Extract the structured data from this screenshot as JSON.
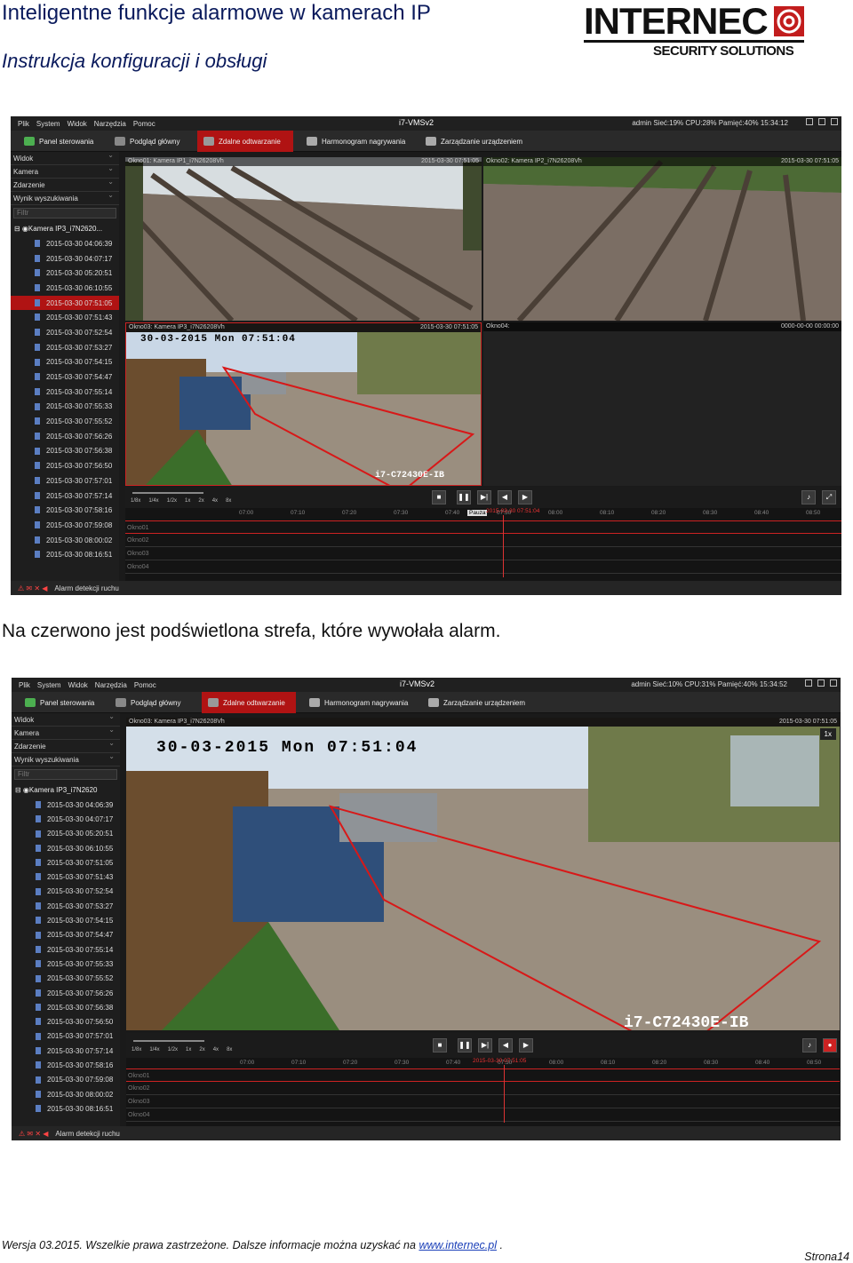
{
  "header": {
    "title": "Inteligentne funkcje alarmowe w kamerach IP",
    "subtitle": "Instrukcja konfiguracji i obsługi"
  },
  "logo": {
    "brand": "INTERNEC",
    "tagline": "SECURITY SOLUTIONS"
  },
  "caption": "Na czerwono jest podświetlona strefa, które wywołała alarm.",
  "footer": {
    "text": "Wersja 03.2015. Wszelkie prawa zastrzeżone. Dalsze informacje można uzyskać na",
    "link": "www.internec.pl",
    "end": " .",
    "page": "Strona14"
  },
  "app": {
    "menu": [
      "Plik",
      "System",
      "Widok",
      "Narzędzia",
      "Pomoc"
    ],
    "title": "i7-VMSv2",
    "tabs": [
      "Panel sterowania",
      "Podgląd główny",
      "Zdalne odtwarzanie",
      "Harmonogram nagrywania",
      "Zarządzanie urządzeniem"
    ],
    "sidebar": {
      "sections": [
        "Widok",
        "Kamera",
        "Zdarzenie",
        "Wynik wyszukiwania"
      ],
      "filter": "Filtr",
      "camera": "Kamera IP3_i7N2620...",
      "camera2": "Kamera IP3_i7N2620",
      "items": [
        "2015-03-30 04:06:39",
        "2015-03-30 04:07:17",
        "2015-03-30 05:20:51",
        "2015-03-30 06:10:55",
        "2015-03-30 07:51:05",
        "2015-03-30 07:51:43",
        "2015-03-30 07:52:54",
        "2015-03-30 07:53:27",
        "2015-03-30 07:54:15",
        "2015-03-30 07:54:47",
        "2015-03-30 07:55:14",
        "2015-03-30 07:55:33",
        "2015-03-30 07:55:52",
        "2015-03-30 07:56:26",
        "2015-03-30 07:56:38",
        "2015-03-30 07:56:50",
        "2015-03-30 07:57:01",
        "2015-03-30 07:57:14",
        "2015-03-30 07:58:16",
        "2015-03-30 07:59:08",
        "2015-03-30 08:00:02",
        "2015-03-30 08:16:51"
      ]
    },
    "bottom": "Alarm detekcji ruchu",
    "speeds": [
      "1/8x",
      "1/4x",
      "1/2x",
      "1x",
      "2x",
      "4x",
      "8x"
    ],
    "rows": [
      "Okno01",
      "Okno02",
      "Okno03",
      "Okno04"
    ]
  },
  "shot1": {
    "sys": "admin  Sieć:19%  CPU:28%  Pamięć:40%  15:34:12",
    "windows": [
      {
        "name": "Okno01: Kamera IP1_i7N26208Vh",
        "time": "2015-03-30 07:51:05"
      },
      {
        "name": "Okno02: Kamera IP2_i7N26208Vh",
        "time": "2015-03-30 07:51:05"
      },
      {
        "name": "Okno03: Kamera IP3_i7N26208Vh",
        "time": "2015-03-30 07:51:05"
      },
      {
        "name": "Okno04:",
        "time": "0000-00-00 00:00:00"
      }
    ],
    "osd": "30-03-2015 Mon 07:51:04",
    "osd2": "i7-C72430E-IB",
    "ticks": [
      "07:00",
      "07:10",
      "07:20",
      "07:30",
      "07:40",
      "07:50",
      "08:00",
      "08:10",
      "08:20",
      "08:30",
      "08:40",
      "08:50"
    ],
    "pause": "Pauza",
    "cursor_time": "2015-03-30 07:51:04"
  },
  "shot2": {
    "sys": "admin  Sieć:10%  CPU:31%  Pamięć:40%  15:34:52",
    "window": {
      "name": "Okno03: Kamera IP3_i7N26208Vh",
      "time": "2015-03-30 07:51:05"
    },
    "osd": "30-03-2015 Mon 07:51:04",
    "osd2": "i7-C72430E-IB",
    "speed": "1x",
    "ticks": [
      "07:00",
      "07:10",
      "07:20",
      "07:30",
      "07:40",
      "07:50",
      "08:00",
      "08:10",
      "08:20",
      "08:30",
      "08:40",
      "08:50"
    ],
    "cursor_time": "2015-03-30 07:51:05"
  }
}
